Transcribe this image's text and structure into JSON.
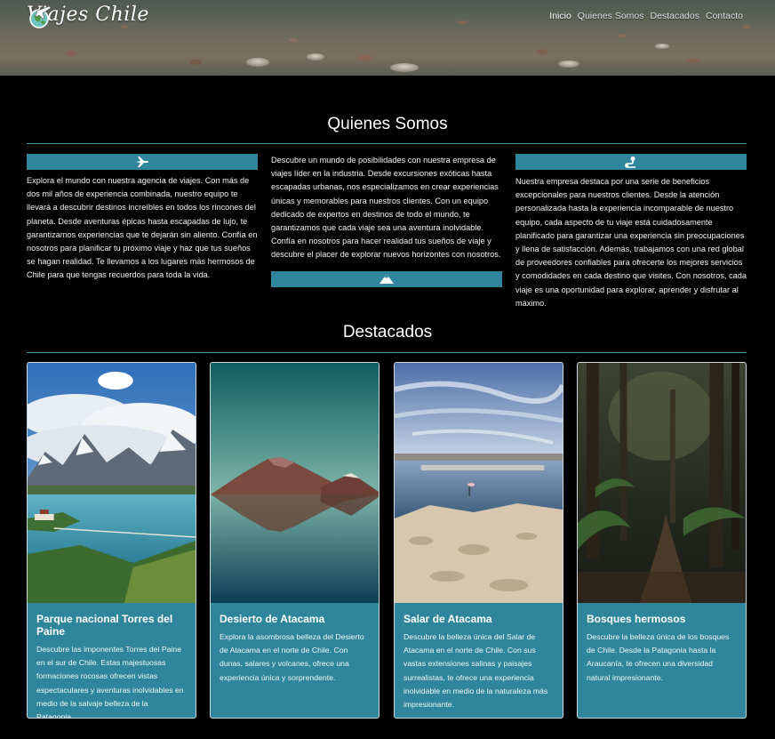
{
  "header": {
    "brand": "Viajes Chile",
    "logo_icon": "globe-plane-icon",
    "nav": [
      {
        "label": "Inicio",
        "active": true
      },
      {
        "label": "Quienes Somos",
        "active": false
      },
      {
        "label": "Destacados",
        "active": false
      },
      {
        "label": "Contacto",
        "active": false
      }
    ]
  },
  "about": {
    "title": "Quienes Somos",
    "columns": [
      {
        "icon": "airplane-icon",
        "text": "Explora el mundo con nuestra agencia de viajes. Con más de dos mil años de experiencia combinada, nuestro equipo te llevará a descubrir destinos increíbles en todos los rincones del planeta. Desde aventuras épicas hasta escapadas de lujo, te garantizamos experiencias que te dejarán sin aliento. Confía en nosotros para planificar tu próximo viaje y haz que tus sueños se hagan realidad. Te llevamos a los lugares más hermosos de Chile para que tengas recuerdos para toda la vida."
      },
      {
        "icon": "mountain-icon",
        "text": "Descubre un mundo de posibilidades con nuestra empresa de viajes líder en la industria. Desde excursiones exóticas hasta escapadas urbanas, nos especializamos en crear experiencias únicas y memorables para nuestros clientes. Con un equipo dedicado de expertos en destinos de todo el mundo, te garantizamos que cada viaje sea una aventura inolvidable. Confía en nosotros para hacer realidad tus sueños de viaje y descubre el placer de explorar nuevos horizontes con nosotros."
      },
      {
        "icon": "route-icon",
        "text": "Nuestra empresa destaca por una serie de beneficios excepcionales para nuestros clientes. Desde la atención personalizada hasta la experiencia incomparable de nuestro equipo, cada aspecto de tu viaje está cuidadosamente planificado para garantizar una experiencia sin preocupaciones y llena de satisfacción. Además, trabajamos con una red global de proveedores confiables para ofrecerte los mejores servicios y comodidades en cada destino que visites. Con nosotros, cada viaje es una oportunidad para explorar, aprender y disfrutar al máximo."
      }
    ]
  },
  "featured": {
    "title": "Destacados",
    "cards": [
      {
        "title": "Parque nacional Torres del Paine",
        "text": "Descubre las imponentes Torres del Paine en el sur de Chile. Estas majestuosas formaciones rocosas ofrecen vistas espectaculares y aventuras inolvidables en medio de la salvaje belleza de la Patagonia."
      },
      {
        "title": "Desierto de Atacama",
        "text": "Explora la asombrosa belleza del Desierto de Atacama en el norte de Chile. Con dunas, salares y volcanes, ofrece una experiencia única y sorprendente."
      },
      {
        "title": "Salar de Atacama",
        "text": "Descubre la belleza única del Salar de Atacama en el norte de Chile. Con sus vastas extensiones salinas y paisajes surrealistas, te ofrece una experiencia inolvidable en medio de la naturaleza más impresionante."
      },
      {
        "title": "Bosques hermosos",
        "text": "Descubre la belleza única de los bosques de Chile. Desde la Patagonia hasta la Araucanía, te ofrecen una diversidad natural impresionante."
      }
    ]
  },
  "colors": {
    "accent": "#2f869c",
    "background": "#000000",
    "rule": "#3e8fa6"
  }
}
